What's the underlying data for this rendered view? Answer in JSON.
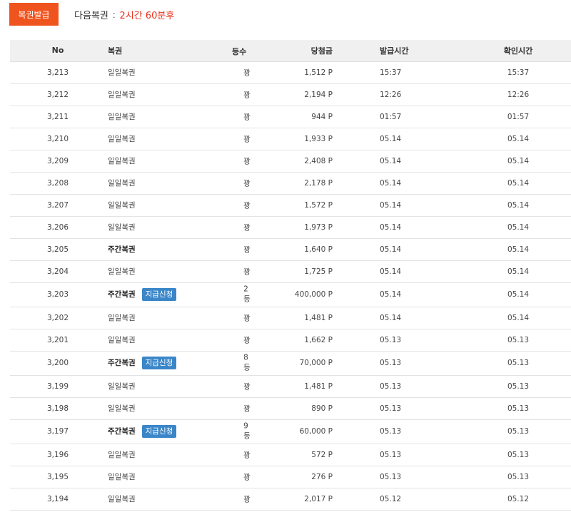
{
  "top": {
    "issue_button": "복권발급",
    "next_label": "다음복권",
    "next_sep": ":",
    "next_time": "2시간 60분후"
  },
  "table": {
    "headers": {
      "no": "No",
      "name": "복권",
      "rank": "등수",
      "prize": "당첨금",
      "issue": "발급시간",
      "check": "확인시간"
    },
    "rows": [
      {
        "no": "3,213",
        "name": "일일복권",
        "bold": false,
        "apply": "",
        "rank": "꽝",
        "prize": "1,512 P",
        "issue": "15:37",
        "check": "15:37"
      },
      {
        "no": "3,212",
        "name": "일일복권",
        "bold": false,
        "apply": "",
        "rank": "꽝",
        "prize": "2,194 P",
        "issue": "12:26",
        "check": "12:26"
      },
      {
        "no": "3,211",
        "name": "일일복권",
        "bold": false,
        "apply": "",
        "rank": "꽝",
        "prize": "944 P",
        "issue": "01:57",
        "check": "01:57"
      },
      {
        "no": "3,210",
        "name": "일일복권",
        "bold": false,
        "apply": "",
        "rank": "꽝",
        "prize": "1,933 P",
        "issue": "05.14",
        "check": "05.14"
      },
      {
        "no": "3,209",
        "name": "일일복권",
        "bold": false,
        "apply": "",
        "rank": "꽝",
        "prize": "2,408 P",
        "issue": "05.14",
        "check": "05.14"
      },
      {
        "no": "3,208",
        "name": "일일복권",
        "bold": false,
        "apply": "",
        "rank": "꽝",
        "prize": "2,178 P",
        "issue": "05.14",
        "check": "05.14"
      },
      {
        "no": "3,207",
        "name": "일일복권",
        "bold": false,
        "apply": "",
        "rank": "꽝",
        "prize": "1,572 P",
        "issue": "05.14",
        "check": "05.14"
      },
      {
        "no": "3,206",
        "name": "일일복권",
        "bold": false,
        "apply": "",
        "rank": "꽝",
        "prize": "1,973 P",
        "issue": "05.14",
        "check": "05.14"
      },
      {
        "no": "3,205",
        "name": "주간복권",
        "bold": true,
        "apply": "",
        "rank": "꽝",
        "prize": "1,640 P",
        "issue": "05.14",
        "check": "05.14"
      },
      {
        "no": "3,204",
        "name": "일일복권",
        "bold": false,
        "apply": "",
        "rank": "꽝",
        "prize": "1,725 P",
        "issue": "05.14",
        "check": "05.14"
      },
      {
        "no": "3,203",
        "name": "주간복권",
        "bold": true,
        "apply": "지급신청",
        "rank": "2등",
        "prize": "400,000 P",
        "issue": "05.14",
        "check": "05.14"
      },
      {
        "no": "3,202",
        "name": "일일복권",
        "bold": false,
        "apply": "",
        "rank": "꽝",
        "prize": "1,481 P",
        "issue": "05.14",
        "check": "05.14"
      },
      {
        "no": "3,201",
        "name": "일일복권",
        "bold": false,
        "apply": "",
        "rank": "꽝",
        "prize": "1,662 P",
        "issue": "05.13",
        "check": "05.13"
      },
      {
        "no": "3,200",
        "name": "주간복권",
        "bold": true,
        "apply": "지급신청",
        "rank": "8등",
        "prize": "70,000 P",
        "issue": "05.13",
        "check": "05.13"
      },
      {
        "no": "3,199",
        "name": "일일복권",
        "bold": false,
        "apply": "",
        "rank": "꽝",
        "prize": "1,481 P",
        "issue": "05.13",
        "check": "05.13"
      },
      {
        "no": "3,198",
        "name": "일일복권",
        "bold": false,
        "apply": "",
        "rank": "꽝",
        "prize": "890 P",
        "issue": "05.13",
        "check": "05.13"
      },
      {
        "no": "3,197",
        "name": "주간복권",
        "bold": true,
        "apply": "지급신청",
        "rank": "9등",
        "prize": "60,000 P",
        "issue": "05.13",
        "check": "05.13"
      },
      {
        "no": "3,196",
        "name": "일일복권",
        "bold": false,
        "apply": "",
        "rank": "꽝",
        "prize": "572 P",
        "issue": "05.13",
        "check": "05.13"
      },
      {
        "no": "3,195",
        "name": "일일복권",
        "bold": false,
        "apply": "",
        "rank": "꽝",
        "prize": "276 P",
        "issue": "05.13",
        "check": "05.13"
      },
      {
        "no": "3,194",
        "name": "일일복권",
        "bold": false,
        "apply": "",
        "rank": "꽝",
        "prize": "2,017 P",
        "issue": "05.12",
        "check": "05.12"
      }
    ]
  },
  "colors": {
    "accent": "#f0541e",
    "apply_button": "#3a86c8",
    "timer_text": "#e8321e",
    "header_bg": "#f0f0f0"
  }
}
